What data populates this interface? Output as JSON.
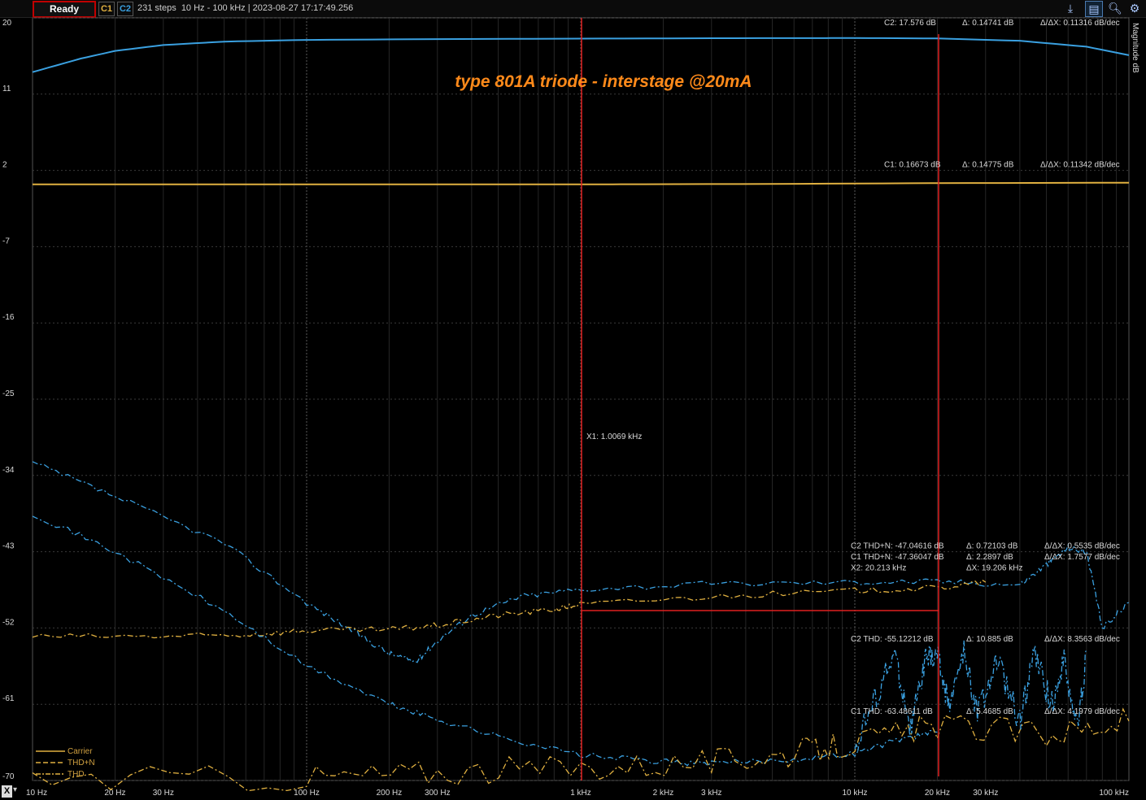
{
  "toolbar": {
    "status": "Ready",
    "c1": "C1",
    "c2": "C2",
    "info": "231 steps  10 Hz - 100 kHz | 2023-08-27 17:17:49.256",
    "icons": [
      "chart-icon",
      "table-icon",
      "zoom-icon",
      "settings-icon"
    ]
  },
  "colors": {
    "c1": "#e0b040",
    "c2": "#3aa0e0",
    "cursor": "#e02020",
    "grid": "#3a3a3a",
    "title": "#ff8a1a"
  },
  "chart_data": {
    "type": "line",
    "title": "type 801A triode - interstage @20mA",
    "xscale": "log",
    "xlim": [
      10,
      100000
    ],
    "ylim": [
      -70,
      20
    ],
    "ylabel": "Magnitude  dB",
    "xticks": [
      {
        "v": 10,
        "label": "10 Hz"
      },
      {
        "v": 20,
        "label": "20 Hz"
      },
      {
        "v": 30,
        "label": "30 Hz"
      },
      {
        "v": 100,
        "label": "100 Hz"
      },
      {
        "v": 200,
        "label": "200 Hz"
      },
      {
        "v": 300,
        "label": "300 Hz"
      },
      {
        "v": 1000,
        "label": "1 kHz"
      },
      {
        "v": 2000,
        "label": "2 kHz"
      },
      {
        "v": 3000,
        "label": "3 kHz"
      },
      {
        "v": 10000,
        "label": "10 kHz"
      },
      {
        "v": 20000,
        "label": "20 kHz"
      },
      {
        "v": 30000,
        "label": "30 kHz"
      },
      {
        "v": 100000,
        "label": "100 kHz"
      }
    ],
    "yticks": [
      20,
      11,
      2,
      -7,
      -16,
      -25,
      -34,
      -43,
      -52,
      -61,
      -70
    ],
    "major_x": [
      100,
      1000,
      10000
    ],
    "series": [
      {
        "key": "c2-carrier",
        "color": "#3aa0e0",
        "style": "solid",
        "points": [
          [
            10,
            13.6
          ],
          [
            15,
            15.2
          ],
          [
            20,
            16.1
          ],
          [
            30,
            16.8
          ],
          [
            50,
            17.2
          ],
          [
            100,
            17.4
          ],
          [
            300,
            17.5
          ],
          [
            1000,
            17.55
          ],
          [
            3000,
            17.6
          ],
          [
            10000,
            17.62
          ],
          [
            20000,
            17.58
          ],
          [
            40000,
            17.3
          ],
          [
            70000,
            16.6
          ],
          [
            100000,
            15.6
          ]
        ]
      },
      {
        "key": "c1-carrier",
        "color": "#e0b040",
        "style": "solid",
        "points": [
          [
            10,
            0.35
          ],
          [
            100,
            0.35
          ],
          [
            1000,
            0.35
          ],
          [
            5000,
            0.4
          ],
          [
            20000,
            0.5
          ],
          [
            100000,
            0.55
          ]
        ]
      },
      {
        "key": "c2-thdn",
        "color": "#3aa0e0",
        "style": "dash",
        "points": [
          [
            10,
            -32.5
          ],
          [
            20,
            -36.5
          ],
          [
            50,
            -42
          ],
          [
            100,
            -49
          ],
          [
            150,
            -52.5
          ],
          [
            200,
            -55
          ],
          [
            250,
            -56
          ],
          [
            300,
            -53.5
          ],
          [
            400,
            -50.5
          ],
          [
            600,
            -48.3
          ],
          [
            1000,
            -47.4
          ],
          [
            3000,
            -46.8
          ],
          [
            10000,
            -46.6
          ],
          [
            20000,
            -46.5
          ],
          [
            40000,
            -46.9
          ],
          [
            50000,
            -44.5
          ],
          [
            60000,
            -42.5
          ],
          [
            70000,
            -43
          ],
          [
            80000,
            -52
          ],
          [
            100000,
            -49
          ]
        ]
      },
      {
        "key": "c1-thdn",
        "color": "#e0b040",
        "style": "dash",
        "points": [
          [
            10,
            -53
          ],
          [
            30,
            -53
          ],
          [
            60,
            -52.8
          ],
          [
            100,
            -52.3
          ],
          [
            200,
            -52.2
          ],
          [
            300,
            -51.7
          ],
          [
            500,
            -50.5
          ],
          [
            800,
            -49.8
          ],
          [
            1000,
            -49.2
          ],
          [
            3000,
            -48.3
          ],
          [
            10000,
            -47.6
          ],
          [
            20000,
            -47.3
          ],
          [
            30000,
            -46.6
          ]
        ]
      },
      {
        "key": "c1-thd-mid",
        "color": "#3aa0e0",
        "style": "dash",
        "points": [
          [
            10,
            -38.5
          ],
          [
            20,
            -43
          ],
          [
            50,
            -50
          ],
          [
            100,
            -56.5
          ],
          [
            200,
            -61
          ],
          [
            300,
            -62.8
          ],
          [
            500,
            -64.8
          ],
          [
            1000,
            -67
          ],
          [
            2000,
            -67.8
          ],
          [
            3000,
            -68
          ],
          [
            6000,
            -67.5
          ],
          [
            10000,
            -66.8
          ],
          [
            15000,
            -65
          ],
          [
            20000,
            -64.3
          ]
        ]
      },
      {
        "key": "c1-thd",
        "color": "#e0b040",
        "style": "dash",
        "points": [
          [
            10,
            -69.8
          ],
          [
            100,
            -69.7
          ],
          [
            300,
            -69
          ],
          [
            1000,
            -68.5
          ],
          [
            3000,
            -67.8
          ],
          [
            6000,
            -66.8
          ],
          [
            10000,
            -65.6
          ],
          [
            20000,
            -63.5
          ],
          [
            50000,
            -64.5
          ],
          [
            100000,
            -63
          ]
        ]
      },
      {
        "key": "c2-thd",
        "color": "#3aa0e0",
        "style": "dash",
        "points": [
          [
            10000,
            -66
          ],
          [
            12000,
            -60
          ],
          [
            14000,
            -55
          ],
          [
            16000,
            -64
          ],
          [
            18000,
            -56
          ],
          [
            20000,
            -55
          ],
          [
            22000,
            -61
          ],
          [
            25000,
            -55
          ],
          [
            28000,
            -62
          ],
          [
            33000,
            -56
          ],
          [
            40000,
            -63
          ],
          [
            45000,
            -55
          ],
          [
            52000,
            -61
          ],
          [
            58000,
            -56
          ],
          [
            65000,
            -64
          ],
          [
            70000,
            -55
          ]
        ]
      }
    ],
    "legend": [
      {
        "label": "Carrier",
        "style": "solid"
      },
      {
        "label": "THD+N",
        "style": "dash"
      },
      {
        "label": "THD",
        "style": "dashdot"
      }
    ],
    "legend_position": "bottom-left",
    "cursors": [
      {
        "label": "X1: 1.0069 kHz",
        "x": 1006.9
      },
      {
        "label": "",
        "x": 20213
      }
    ],
    "annotations": [
      {
        "anchor_y": 20,
        "texts": [
          "C2: 17.576 dB",
          "Δ: 0.14741 dB",
          "Δ/ΔX: 0.11316 dB/dec"
        ]
      },
      {
        "anchor_y": 2,
        "texts": [
          "C1: 0.16673 dB",
          "Δ: 0.14775 dB",
          "Δ/ΔX: 0.11342 dB/dec"
        ]
      },
      {
        "anchor_y": -43,
        "texts": [
          "C2 THD+N: -47.04616 dB",
          "Δ: 0.72103 dB",
          "Δ/ΔX: 0.5535 dB/dec"
        ]
      },
      {
        "anchor_y": -44.3,
        "texts": [
          "C1 THD+N: -47.36047 dB",
          "Δ: 2.2897 dB",
          "Δ/ΔX: 1.7577 dB/dec"
        ]
      },
      {
        "anchor_y": -45.6,
        "texts": [
          "X2: 20.213 kHz",
          "ΔX: 19.206 kHz",
          ""
        ]
      },
      {
        "anchor_y": -54,
        "texts": [
          "C2 THD: -55.12212 dB",
          "Δ: 10.885 dB",
          "Δ/ΔX: 8.3563 dB/dec"
        ]
      },
      {
        "anchor_y": -62.5,
        "texts": [
          "C1 THD: -63.48611 dB",
          "Δ: 5.4685 dB",
          "Δ/ΔX: 4.1979 dB/dec"
        ]
      }
    ]
  }
}
